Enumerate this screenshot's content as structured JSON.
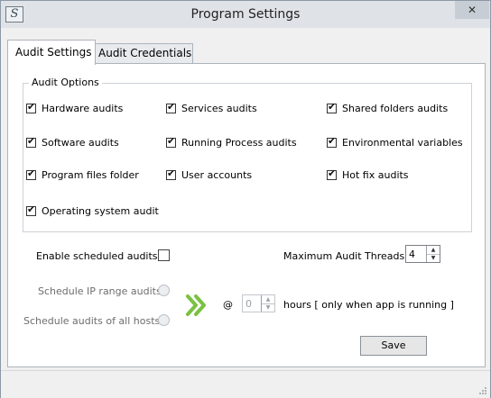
{
  "window": {
    "title": "Program Settings",
    "icon_letter": "S",
    "close_label": "✕"
  },
  "tabs": [
    {
      "label": "Audit Settings",
      "active": true
    },
    {
      "label": "Audit Credentials",
      "active": false
    }
  ],
  "audit_options": {
    "legend": "Audit Options",
    "items": [
      {
        "label": "Hardware audits",
        "checked": true
      },
      {
        "label": "Services audits",
        "checked": true
      },
      {
        "label": "Shared folders audits",
        "checked": true
      },
      {
        "label": "Software audits",
        "checked": true
      },
      {
        "label": "Running Process audits",
        "checked": true
      },
      {
        "label": "Environmental variables",
        "checked": true
      },
      {
        "label": "Program files folder",
        "checked": true
      },
      {
        "label": "User accounts",
        "checked": true
      },
      {
        "label": "Hot fix audits",
        "checked": true
      },
      {
        "label": "Operating system audit",
        "checked": true
      }
    ]
  },
  "schedule": {
    "enable_label": "Enable scheduled audits",
    "enable_checked": false,
    "max_threads_label": "Maximum Audit Threads",
    "max_threads_value": "4",
    "ip_range_label": "Schedule IP range audits",
    "all_hosts_label": "Schedule audits of all hosts",
    "at_symbol": "@",
    "hours_value": "0",
    "hours_label": "hours [ only when app is running ]",
    "arrow_color": "#7ac142"
  },
  "buttons": {
    "save_label": "Save"
  },
  "spin_up": "▲",
  "spin_down": "▼"
}
